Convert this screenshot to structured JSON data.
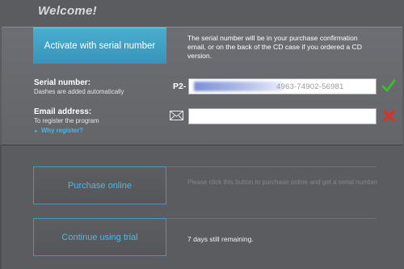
{
  "header": {
    "title": "Welcome!"
  },
  "activate": {
    "button_label": "Activate with serial number",
    "description": "The serial number will be in your purchase confirmation email, or on the back of the CD case if you ordered a CD version."
  },
  "serial": {
    "label": "Serial number:",
    "hint": "Dashes are added automatically",
    "prefix": "P2-",
    "value_visible": "4963-74902-56981",
    "status_icon": "checkmark-icon",
    "status_color": "#3dbb2a"
  },
  "email": {
    "label": "Email address:",
    "hint": "To register the program",
    "value": "",
    "icon": "envelope-icon",
    "status_icon": "cross-icon",
    "status_color": "#e03020"
  },
  "why_register": {
    "label": "Why register?"
  },
  "purchase": {
    "button_label": "Purchase online",
    "description": "Please click this button to purchase online and get a serial number."
  },
  "trial": {
    "button_label": "Continue using trial",
    "description": "7 days still remaining."
  },
  "colors": {
    "accent": "#3fa6cd",
    "link": "#44b8e6",
    "background": "#5b5c60",
    "panel": "#6a6b70"
  }
}
